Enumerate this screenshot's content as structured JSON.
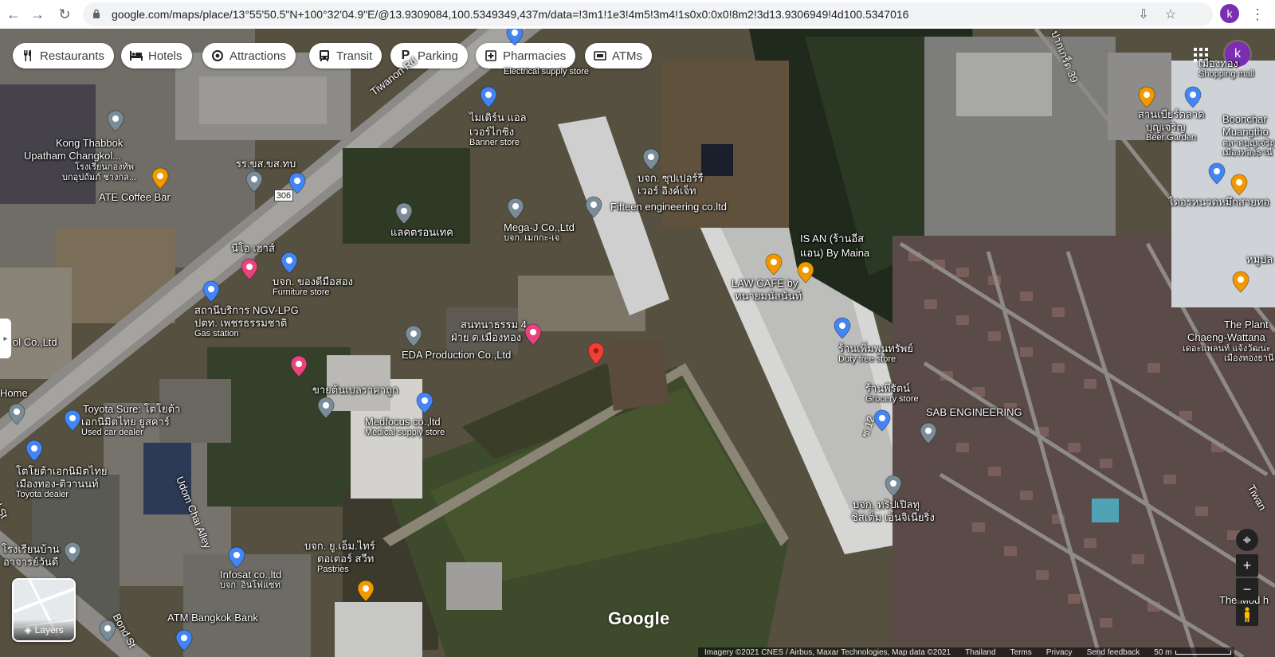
{
  "browser": {
    "url": "google.com/maps/place/13°55'50.5\"N+100°32'04.9\"E/@13.9309084,100.5349349,437m/data=!3m1!1e3!4m5!3m4!1s0x0:0x0!8m2!3d13.9306949!4d100.5347016",
    "profile_initial": "k"
  },
  "chips": [
    {
      "label": "Restaurants",
      "icon": "fork-knife-icon"
    },
    {
      "label": "Hotels",
      "icon": "bed-icon"
    },
    {
      "label": "Attractions",
      "icon": "camera-icon"
    },
    {
      "label": "Transit",
      "icon": "bus-icon"
    },
    {
      "label": "Parking",
      "icon": "parking-icon"
    },
    {
      "label": "Pharmacies",
      "icon": "pharmacy-icon"
    },
    {
      "label": "ATMs",
      "icon": "atm-icon"
    }
  ],
  "places": [
    {
      "name": "Electrical supply store",
      "sub": ""
    },
    {
      "name": "ไมเดิร์น แอล",
      "sub": ""
    },
    {
      "name": "เวอร์ไกซิ่ง",
      "sub": "Banner store"
    },
    {
      "name": "Kong Thabbok",
      "sub": ""
    },
    {
      "name": "Upatham Changkol...",
      "sub": ""
    },
    {
      "name": "โรงเรียนกองทัพ",
      "sub": ""
    },
    {
      "name": "บกอุปถัมภ์ ช่างกล...",
      "sub": ""
    },
    {
      "name": "ATE Coffee Bar",
      "sub": ""
    },
    {
      "name": "รร.ขส.ขส.ทบ",
      "sub": ""
    },
    {
      "name": "บจก. ซุปเปอร์รี",
      "sub": ""
    },
    {
      "name": "เวอร์ อิงค์เจ็ท",
      "sub": ""
    },
    {
      "name": "Fifteen engineering co.ltd",
      "sub": ""
    },
    {
      "name": "Mega-J Co.,Ltd",
      "sub": "บจก. เมกกะ-เจ"
    },
    {
      "name": "แลคตรอนเทค",
      "sub": ""
    },
    {
      "name": "IS AN (ร้านอีส",
      "sub": ""
    },
    {
      "name": "แอน) By Maina",
      "sub": ""
    },
    {
      "name": "LAW CAFE by",
      "sub": ""
    },
    {
      "name": "ทนายมนัสนันท์",
      "sub": ""
    },
    {
      "name": "นีโอ เฮาส์",
      "sub": ""
    },
    {
      "name": "บจก. ของดีมือสอง",
      "sub": "Furniture store"
    },
    {
      "name": "สถานีบริการ NGV-LPG",
      "sub": ""
    },
    {
      "name": "ปตท. เพชรธรรมชาติ",
      "sub": "Gas station"
    },
    {
      "name": "สนทนาธรรม 4",
      "sub": ""
    },
    {
      "name": "ฝ่าย ต.เมืองทอง",
      "sub": ""
    },
    {
      "name": "EDA Production Co.,Ltd",
      "sub": ""
    },
    {
      "name": "ol Co.,Ltd",
      "sub": ""
    },
    {
      "name": "Home",
      "sub": ""
    },
    {
      "name": "Toyota Sure: โตโยต้า",
      "sub": ""
    },
    {
      "name": "เอกนิมิตไทย ยูสคาร์",
      "sub": "Used car dealer"
    },
    {
      "name": "ขายต้นเบลราคาถูก",
      "sub": ""
    },
    {
      "name": "Medfocus co.,ltd",
      "sub": "Medical supply store"
    },
    {
      "name": "โตโยต้าเอกนิมิตไทย",
      "sub": ""
    },
    {
      "name": "เมืองทอง-ติวานนท์",
      "sub": "Toyota dealer"
    },
    {
      "name": "ร้านเพิ่มพูนทรัพย์",
      "sub": "Duty free store"
    },
    {
      "name": "ร้านพีรัตน์",
      "sub": "Grocery store"
    },
    {
      "name": "SAB ENGINEERING",
      "sub": ""
    },
    {
      "name": "บจก. ทริปเปิลทู",
      "sub": ""
    },
    {
      "name": "ซิสเต็ม เอ็นจิเนียริ่ง",
      "sub": ""
    },
    {
      "name": "บจก. ยู.เอ็ม.ไทร์",
      "sub": ""
    },
    {
      "name": "ดอเตอร์ สวีท",
      "sub": "Pastries"
    },
    {
      "name": "Infosat co.,ltd",
      "sub": "บจก. อินโฟแซท"
    },
    {
      "name": "ATM Bangkok Bank",
      "sub": ""
    },
    {
      "name": "โรงเรียนบ้าน",
      "sub": ""
    },
    {
      "name": "อาจารย์วันดี",
      "sub": ""
    },
    {
      "name": "สานเบียร์ตลาด",
      "sub": ""
    },
    {
      "name": "บุญเจริญ",
      "sub": "Beer Garden"
    },
    {
      "name": "Boonchar",
      "sub": ""
    },
    {
      "name": "Muangtho",
      "sub": ""
    },
    {
      "name": "ตลาดบุญเจริญ",
      "sub": ""
    },
    {
      "name": "เมืองทองธานี",
      "sub": ""
    },
    {
      "name": "ไดอรหนวดหมึกสายทอ",
      "sub": ""
    },
    {
      "name": "The Plant",
      "sub": ""
    },
    {
      "name": "Chaeng-Wattana",
      "sub": ""
    },
    {
      "name": "เดอะแพลนท์ แจ้งวัฒนะ",
      "sub": ""
    },
    {
      "name": "เมืองทองธานี",
      "sub": ""
    },
    {
      "name": "เมืองทอง",
      "sub": "Shopping mall"
    },
    {
      "name": "หมูปล",
      "sub": ""
    },
    {
      "name": "The Mod h",
      "sub": ""
    }
  ],
  "roads": [
    {
      "name": "Tiwanon Rd"
    },
    {
      "name": "Udom Chai Alley"
    },
    {
      "name": "Bond St"
    },
    {
      "name": "ซ.12"
    },
    {
      "name": "ปากเกร็ด 39"
    },
    {
      "name": "Tiwan"
    },
    {
      "name": "306"
    },
    {
      "name": "d St"
    }
  ],
  "map": {
    "google_logo": "Google",
    "layers_label": "Layers",
    "attribution": "Imagery ©2021 CNES / Airbus, Maxar Technologies, Map data ©2021",
    "footer_links": [
      "Thailand",
      "Terms",
      "Privacy",
      "Send feedback"
    ],
    "scale": "50 m",
    "zoom_in": "+",
    "zoom_out": "−"
  },
  "colors": {
    "marker_red": "#ea4335",
    "pin_blue": "#4285f4",
    "pin_slate": "#7b8c99",
    "pin_orange": "#f29900",
    "pin_pink": "#e8437d",
    "avatar": "#7b2db4"
  }
}
